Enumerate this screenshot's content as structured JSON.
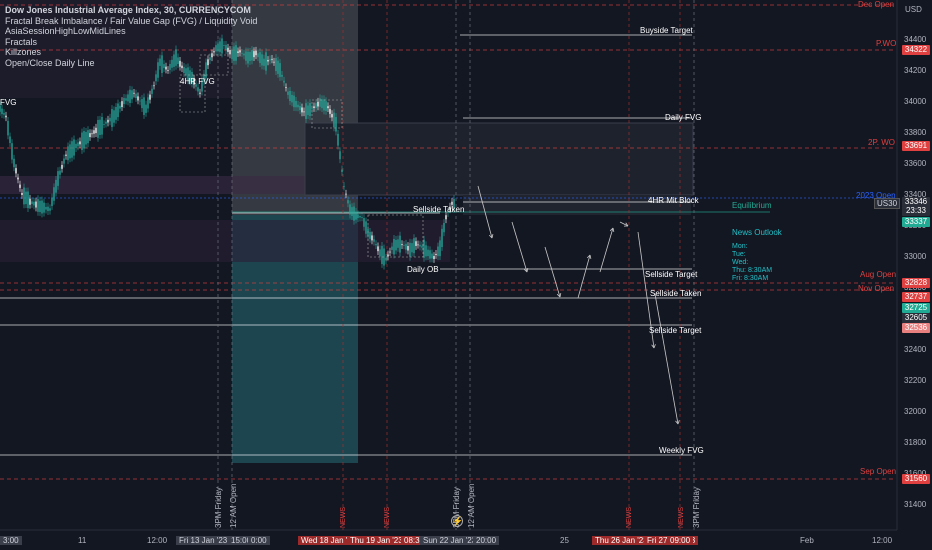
{
  "header": {
    "title": "Dow Jones Industrial Average Index, 30, CURRENCYCOM",
    "indicators": [
      "Fractal Break Imbalance / Fair Value Gap (FVG) / Liquidity Void",
      "AsiaSessionHighLowMidLines",
      "Fractals",
      "Killzones",
      "Open/Close Daily Line"
    ]
  },
  "currency": "USD",
  "symbol_tag": "US30",
  "price_axis": [
    "34400",
    "34200",
    "34000",
    "33800",
    "33600",
    "33400",
    "33200",
    "33000",
    "32800",
    "32600",
    "32400",
    "32200",
    "32000",
    "31800",
    "31600",
    "31400"
  ],
  "price_tags": [
    {
      "text": "34322",
      "color": "#e04040"
    },
    {
      "text": "33691",
      "color": "#e04040"
    },
    {
      "text": "33346",
      "color": "#2a2e39"
    },
    {
      "text": "23:33",
      "color": "#2a2e39"
    },
    {
      "text": "33337",
      "color": "#22ab94"
    },
    {
      "text": "32828",
      "color": "#e04040"
    },
    {
      "text": "32737",
      "color": "#e04040"
    },
    {
      "text": "32725",
      "color": "#22ab94"
    },
    {
      "text": "32605",
      "color": "#2a2e39"
    },
    {
      "text": "32536",
      "color": "#e88080"
    },
    {
      "text": "31560",
      "color": "#e04040"
    }
  ],
  "levels": [
    {
      "label": "Dec Open",
      "color": "#e04040"
    },
    {
      "label": "Buyside Target",
      "color": "#ffffff"
    },
    {
      "label": "P.WO",
      "color": "#e04040"
    },
    {
      "label": "Daily FVG",
      "color": "#ffffff"
    },
    {
      "label": "2P. WO",
      "color": "#e04040"
    },
    {
      "label": "2023 Open",
      "color": "#2962ff"
    },
    {
      "label": "4HR Mit Block",
      "color": "#ffffff"
    },
    {
      "label": "Equilibrium",
      "color": "#22ab94"
    },
    {
      "label": "Sellside Taken",
      "color": "#ffffff"
    },
    {
      "label": "Sellside Target",
      "color": "#ffffff"
    },
    {
      "label": "Aug Open",
      "color": "#e04040"
    },
    {
      "label": "Nov Open",
      "color": "#e04040"
    },
    {
      "label": "Sellside Taken",
      "color": "#ffffff"
    },
    {
      "label": "Sellside Target",
      "color": "#ffffff"
    },
    {
      "label": "Weekly FVG",
      "color": "#ffffff"
    },
    {
      "label": "Sep Open",
      "color": "#e04040"
    }
  ],
  "chart_labels": {
    "fvg_4hr": "4HR FVG",
    "fvg_left": "FVG",
    "daily_ob": "Daily OB"
  },
  "news_outlook": {
    "title": "News Outlook",
    "lines": [
      "Mon:",
      "Tue:",
      "Wed:",
      "Thu: 8:30AM",
      "Fri: 8:30AM"
    ]
  },
  "time_axis": [
    {
      "text": "3:00",
      "style": "hl"
    },
    {
      "text": "11",
      "style": ""
    },
    {
      "text": "12:00",
      "style": ""
    },
    {
      "text": "Fri 13 Jan '23",
      "style": "hl"
    },
    {
      "text": "15:00",
      "style": "hl"
    },
    {
      "text": "0:00",
      "style": "hl"
    },
    {
      "text": "Wed 18 Jan '23",
      "style": "red"
    },
    {
      "text": "Thu 19 Jan '23",
      "style": "red"
    },
    {
      "text": "08:30",
      "style": "red"
    },
    {
      "text": "Sun 22 Jan '23",
      "style": "hl"
    },
    {
      "text": "20:00",
      "style": "hl"
    },
    {
      "text": "25",
      "style": ""
    },
    {
      "text": "Thu 26 Jan '23",
      "style": "red"
    },
    {
      "text": "Fri 27 Jan '23",
      "style": "red"
    },
    {
      "text": "09:00",
      "style": "red"
    },
    {
      "text": "Feb",
      "style": ""
    },
    {
      "text": "12:00",
      "style": ""
    }
  ],
  "vertical_labels": [
    "3PM Friday",
    "12 AM Open",
    "3PM Friday",
    "12 AM Open",
    "3PM Friday"
  ],
  "news_markers": [
    "NEWS",
    "NEWS",
    "NEWS",
    "NEWS"
  ]
}
